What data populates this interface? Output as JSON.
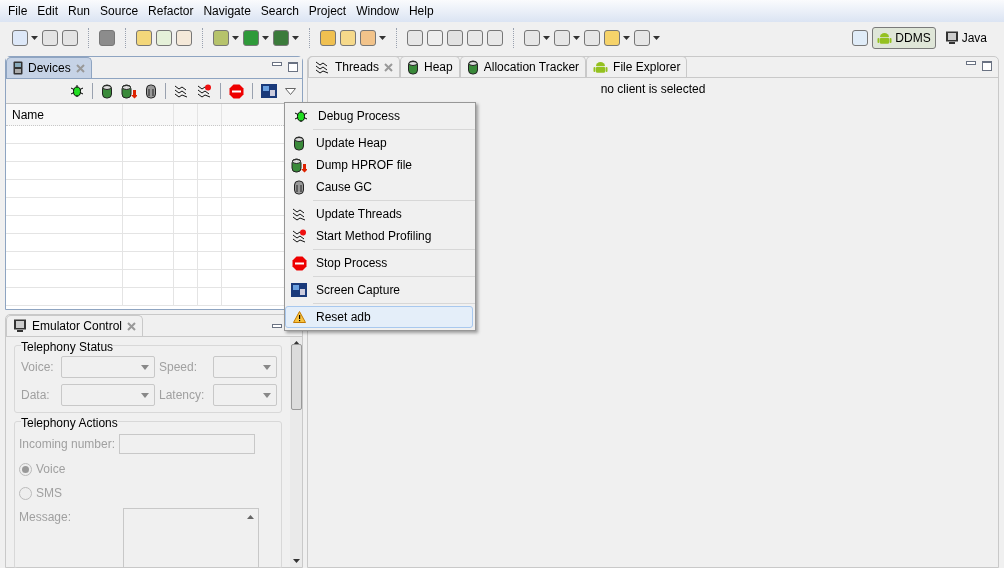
{
  "menu_bar": [
    "File",
    "Edit",
    "Run",
    "Source",
    "Refactor",
    "Navigate",
    "Search",
    "Project",
    "Window",
    "Help"
  ],
  "perspectives": [
    {
      "label": "DDMS",
      "selected": true
    },
    {
      "label": "Java",
      "selected": false
    }
  ],
  "devices_panel": {
    "tab": "Devices",
    "table": {
      "columns": [
        "Name"
      ]
    }
  },
  "emulator_panel": {
    "tab": "Emulator Control",
    "disabled": true,
    "status_group": {
      "title": "Telephony Status",
      "fields": [
        "Voice:",
        "Speed:",
        "Data:",
        "Latency:"
      ]
    },
    "actions_group": {
      "title": "Telephony Actions",
      "incoming_label": "Incoming number:",
      "radios": [
        {
          "label": "Voice",
          "selected": true
        },
        {
          "label": "SMS",
          "selected": false
        }
      ],
      "message_label": "Message:"
    }
  },
  "editor_tabs": [
    {
      "label": "Threads",
      "selected": true
    },
    {
      "label": "Heap",
      "selected": false
    },
    {
      "label": "Allocation Tracker",
      "selected": false
    },
    {
      "label": "File Explorer",
      "selected": false
    }
  ],
  "status_message": "no client is selected",
  "context_menu": {
    "groups": [
      {
        "items": [
          {
            "label": "Debug Process",
            "selected": false
          }
        ]
      },
      {
        "items": [
          {
            "label": "Update Heap",
            "selected": false
          },
          {
            "label": "Dump HPROF file",
            "selected": false
          },
          {
            "label": "Cause GC",
            "selected": false
          }
        ]
      },
      {
        "items": [
          {
            "label": "Update Threads",
            "selected": false
          },
          {
            "label": "Start Method Profiling",
            "selected": false
          }
        ]
      },
      {
        "items": [
          {
            "label": "Stop Process",
            "selected": false
          }
        ]
      },
      {
        "items": [
          {
            "label": "Screen Capture",
            "selected": false
          }
        ]
      },
      {
        "items": [
          {
            "label": "Reset adb",
            "selected": true
          }
        ]
      }
    ]
  }
}
